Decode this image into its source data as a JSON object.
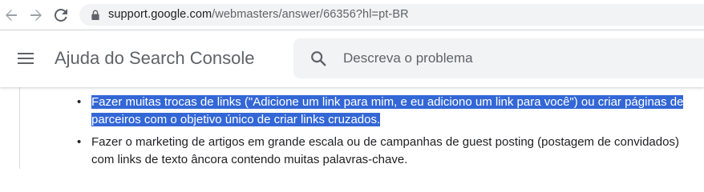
{
  "browser": {
    "url_host": "support.google.com",
    "url_path": "/webmasters/answer/66356?hl=pt-BR",
    "icons": {
      "back": "arrow-left-icon",
      "forward": "arrow-right-icon",
      "reload": "reload-icon",
      "lock": "lock-icon"
    }
  },
  "header": {
    "title": "Ajuda do Search Console",
    "menu_icon": "hamburger-menu-icon",
    "search": {
      "placeholder": "Descreva o problema",
      "value": "",
      "icon": "search-icon"
    }
  },
  "content": {
    "items": [
      {
        "text": "Fazer muitas trocas de links (\"Adicione um link para mim, e eu adiciono um link para você\") ou criar páginas de parceiros com o objetivo único de criar links cruzados.",
        "selected": true
      },
      {
        "text": "Fazer o marketing de artigos em grande escala ou de campanhas de guest posting (postagem de convidados) com links de texto âncora contendo muitas palavras-chave.",
        "selected": false
      }
    ],
    "bullet": "•"
  },
  "colors": {
    "selection": "#3367d6",
    "text": "#202124",
    "muted": "#5f6368",
    "search_bg": "#f1f3f4"
  }
}
